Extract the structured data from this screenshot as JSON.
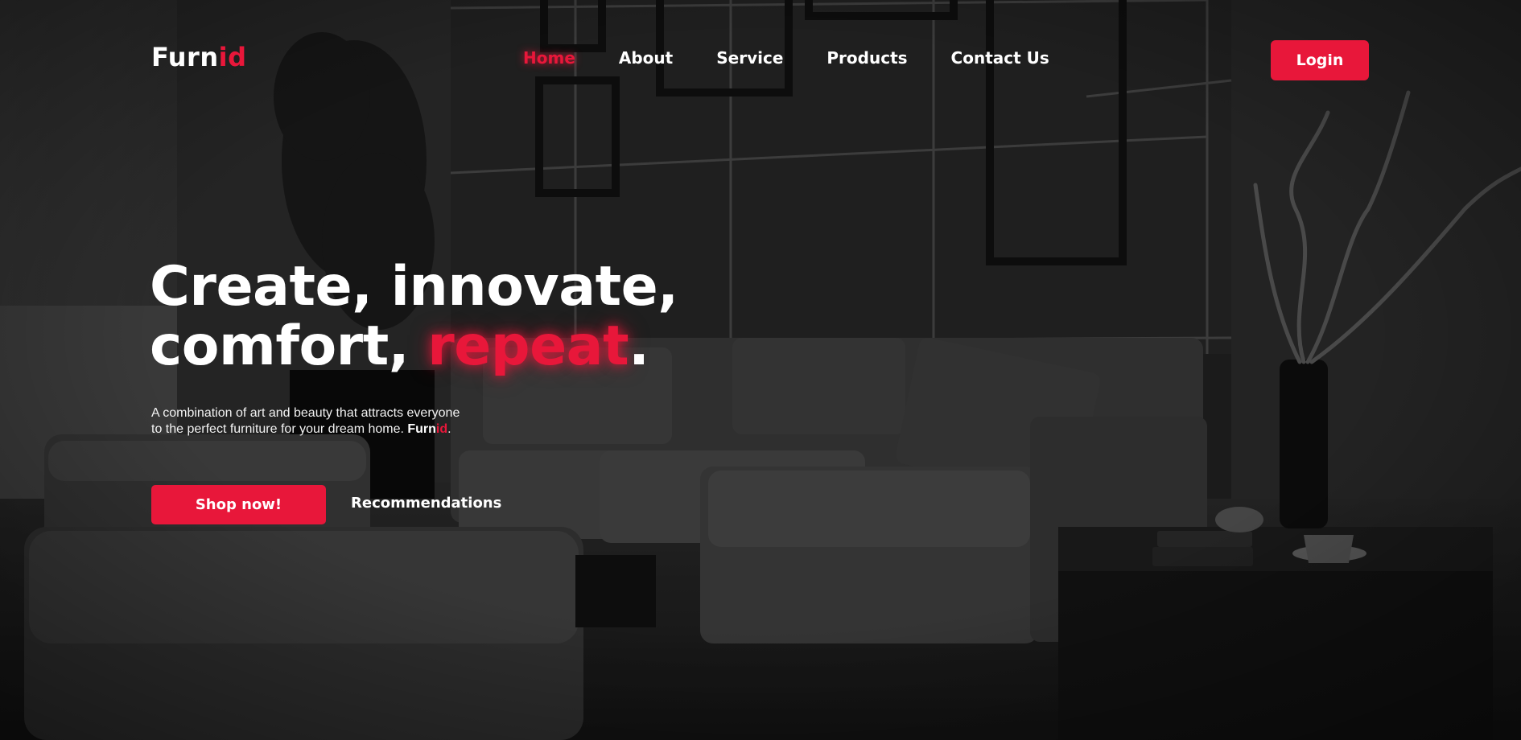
{
  "brand": {
    "name_main": "Furn",
    "name_accent": "id"
  },
  "nav": {
    "items": [
      {
        "label": "Home",
        "active": true
      },
      {
        "label": "About",
        "active": false
      },
      {
        "label": "Service",
        "active": false
      },
      {
        "label": "Products",
        "active": false
      },
      {
        "label": "Contact Us",
        "active": false
      }
    ],
    "login_label": "Login"
  },
  "hero": {
    "headline_line1": "Create, innovate,",
    "headline_line2_start": "comfort, ",
    "headline_highlight": "repeat",
    "headline_end": ".",
    "subtext_line1": "A combination of art and beauty that attracts everyone",
    "subtext_line2": "to the perfect furniture for your dream home. ",
    "subtext_brand_main": "Furn",
    "subtext_brand_accent": "id",
    "subtext_end": ".",
    "primary_cta": "Shop now!",
    "secondary_cta": "Recommendations"
  },
  "colors": {
    "accent": "#e8173a",
    "text": "#ffffff",
    "background": "#1b1b1b"
  }
}
